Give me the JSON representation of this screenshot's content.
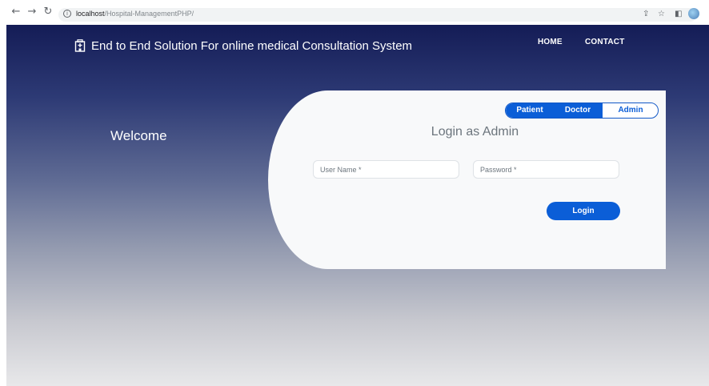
{
  "browser": {
    "url_host": "localhost",
    "url_path": "/Hospital-ManagementPHP/"
  },
  "brand": {
    "title": "End to End Solution For online medical Consultation System"
  },
  "nav": {
    "home": "HOME",
    "contact": "CONTACT"
  },
  "welcome": {
    "text": "Welcome"
  },
  "login": {
    "tabs": {
      "patient": "Patient",
      "doctor": "Doctor",
      "admin": "Admin",
      "selected": "Admin"
    },
    "title": "Login as Admin",
    "username_placeholder": "User Name *",
    "password_placeholder": "Password *",
    "submit_label": "Login"
  },
  "colors": {
    "accent": "#0b5ed7",
    "header_dark": "#141c56"
  }
}
